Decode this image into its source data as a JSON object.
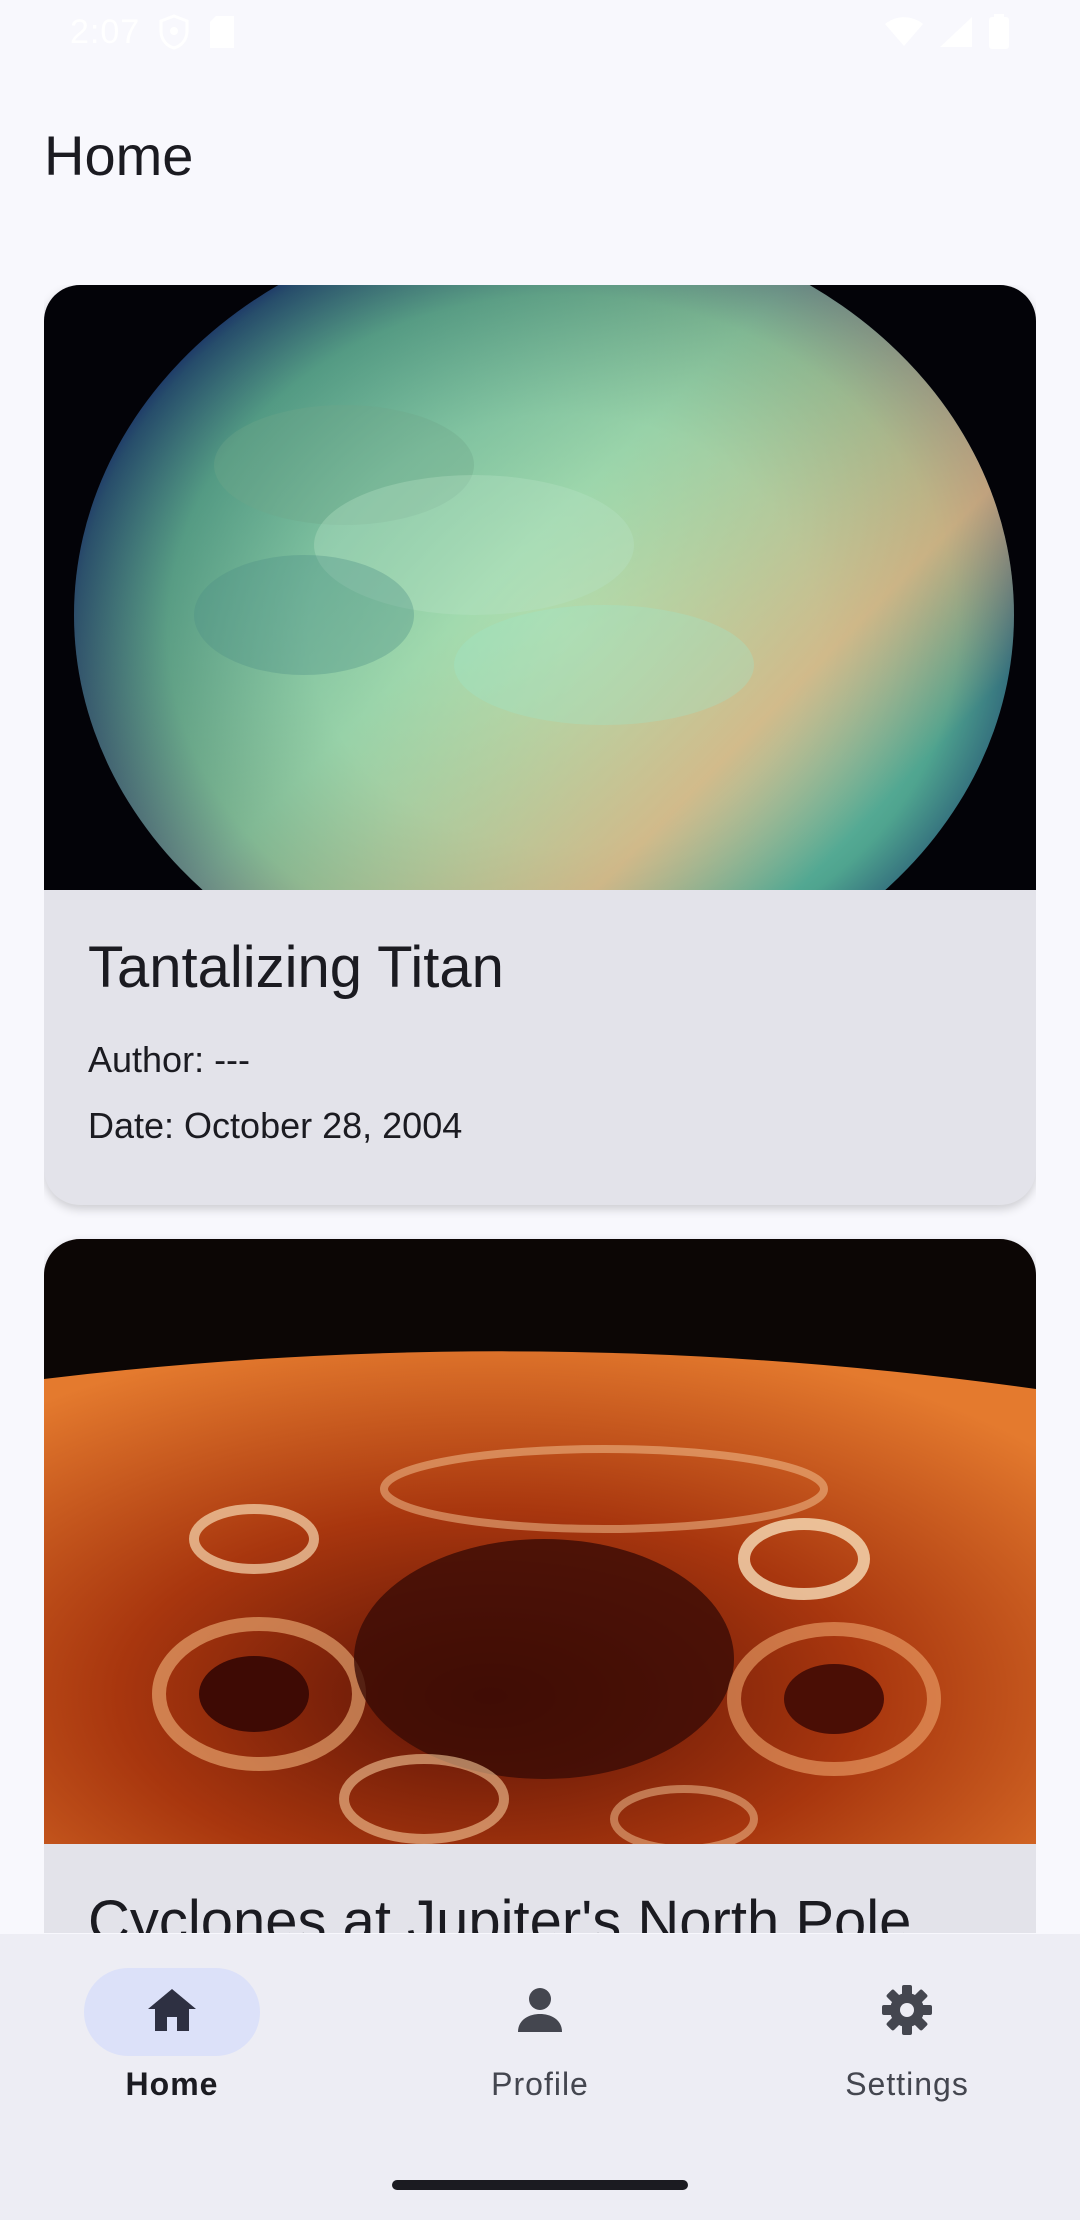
{
  "status_bar": {
    "time": "2:07",
    "icons": [
      "shield-icon",
      "sim-card-icon",
      "wifi-icon",
      "signal-icon",
      "battery-icon"
    ]
  },
  "app_bar": {
    "title": "Home"
  },
  "feed": {
    "items": [
      {
        "title": "Tantalizing Titan",
        "author": "Author: ---",
        "date": "Date: October 28, 2004",
        "image": "titan-photo"
      },
      {
        "title": "Cyclones at Jupiter's North Pole",
        "image": "jupiter-pole-photo"
      }
    ]
  },
  "bottom_nav": {
    "items": [
      {
        "label": "Home",
        "icon": "home-icon",
        "active": true
      },
      {
        "label": "Profile",
        "icon": "person-icon",
        "active": false
      },
      {
        "label": "Settings",
        "icon": "gear-icon",
        "active": false
      }
    ]
  },
  "colors": {
    "background": "#F8F8FD",
    "card": "#E3E3EA",
    "nav_background": "#EDEDF4",
    "nav_indicator": "#DCE1F9",
    "text": "#1B1B21"
  }
}
